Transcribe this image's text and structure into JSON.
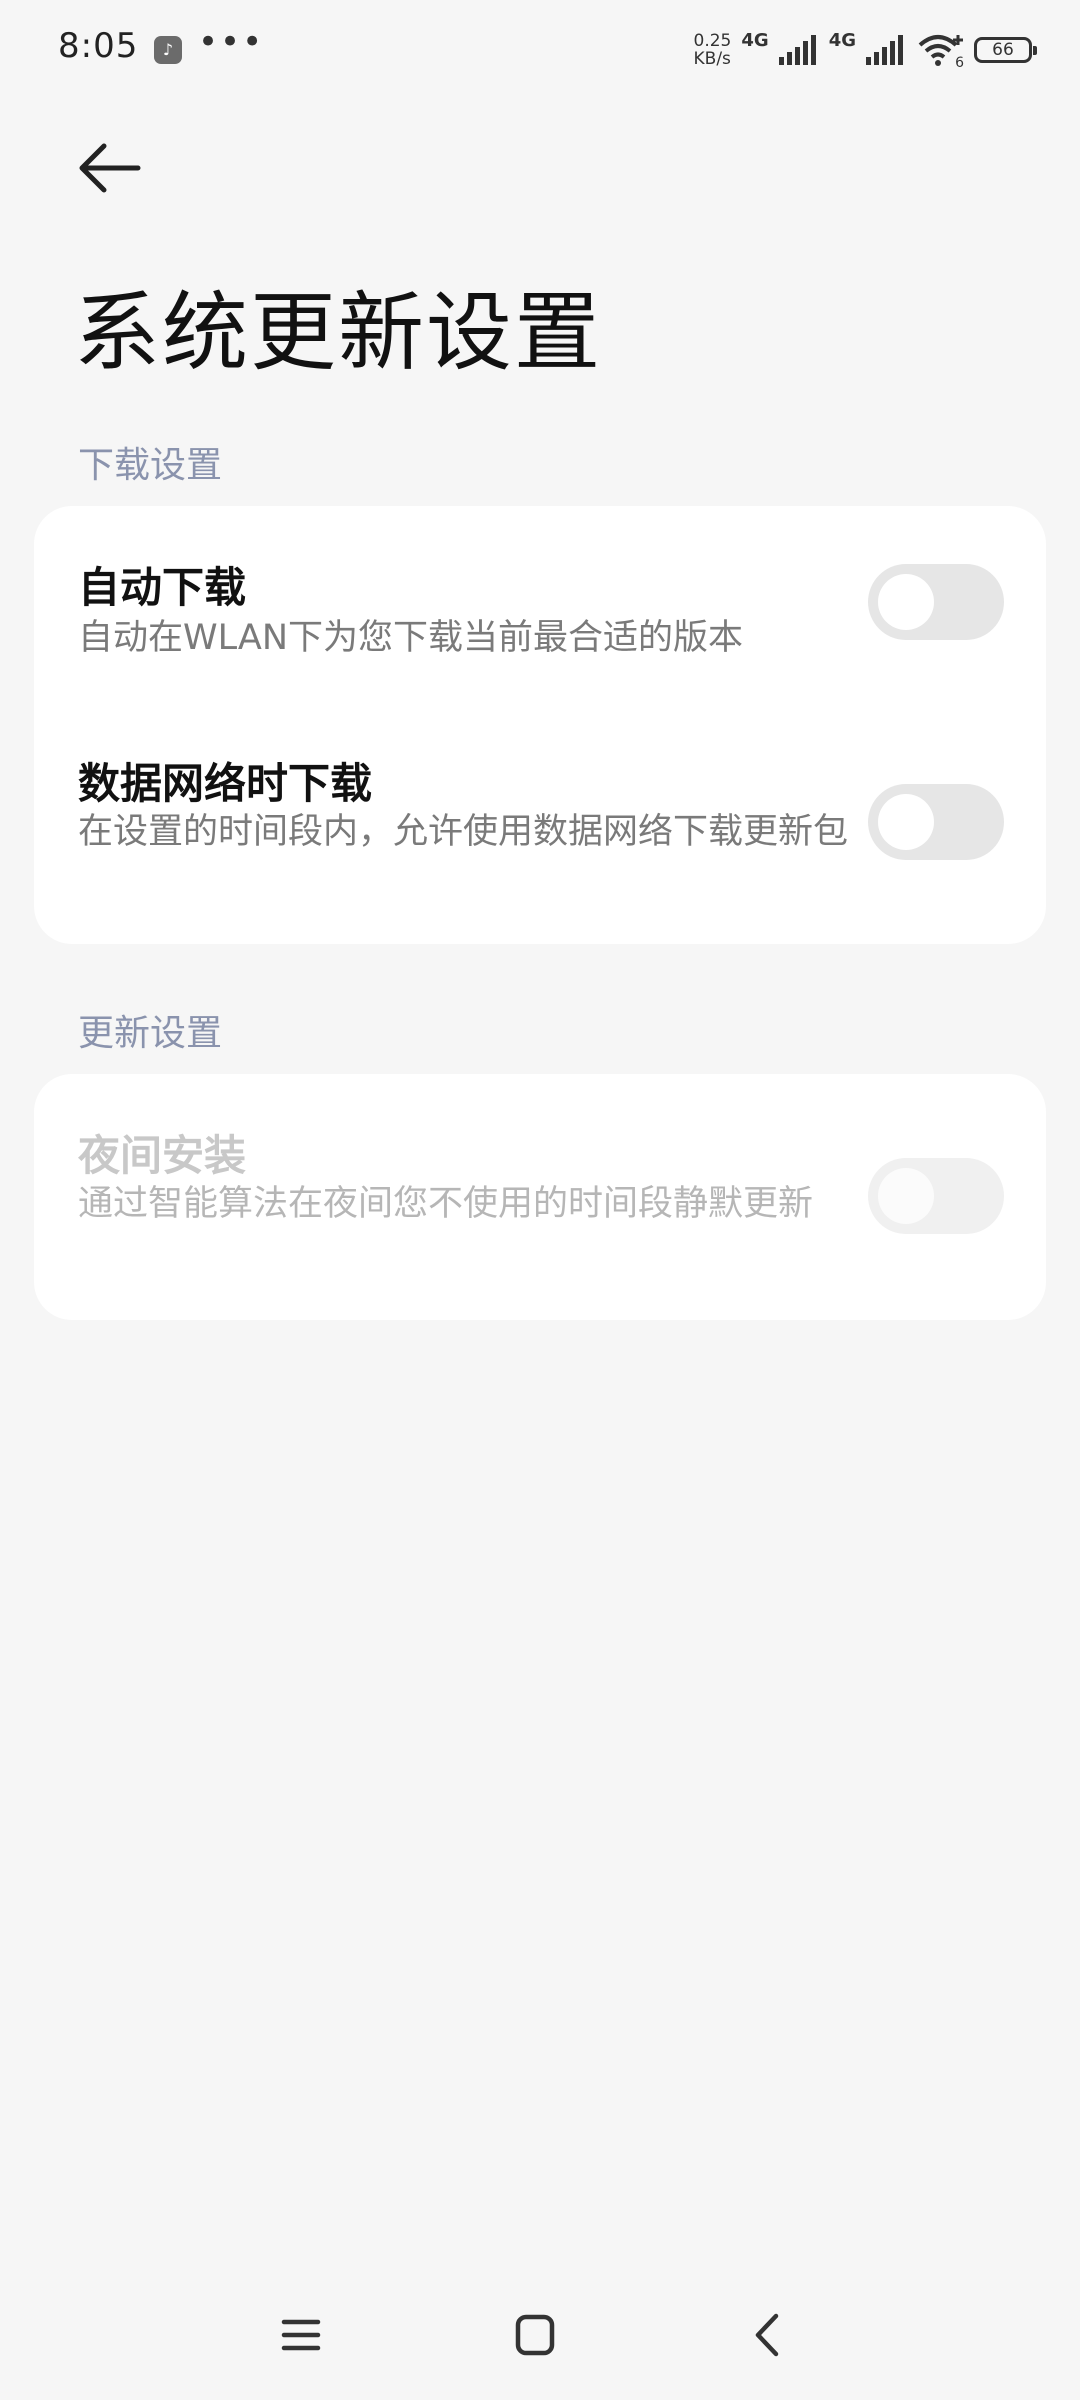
{
  "status_bar": {
    "time": "8:05",
    "app_icon": "tiktok-icon",
    "more_dots": "•••",
    "net_speed_value": "0.25",
    "net_speed_unit": "KB/s",
    "sim1_type": "4G",
    "sim2_type": "4G",
    "wifi_label": "6",
    "battery_level": "66"
  },
  "header": {
    "back_icon": "arrow-left-icon",
    "title": "系统更新设置"
  },
  "sections": [
    {
      "header": "下载设置",
      "items": [
        {
          "title": "自动下载",
          "description": "自动在WLAN下为您下载当前最合适的版本",
          "enabled": false
        },
        {
          "title": "数据网络时下载",
          "description": "在设置的时间段内，允许使用数据网络下载更新包",
          "enabled": false
        }
      ]
    },
    {
      "header": "更新设置",
      "items": [
        {
          "title": "夜间安装",
          "description": "通过智能算法在夜间您不使用的时间段静默更新",
          "enabled": false,
          "disabled": true
        }
      ]
    }
  ],
  "nav_bar": {
    "menu_icon": "menu-icon",
    "home_icon": "home-square-icon",
    "back_icon": "chevron-left-icon"
  }
}
